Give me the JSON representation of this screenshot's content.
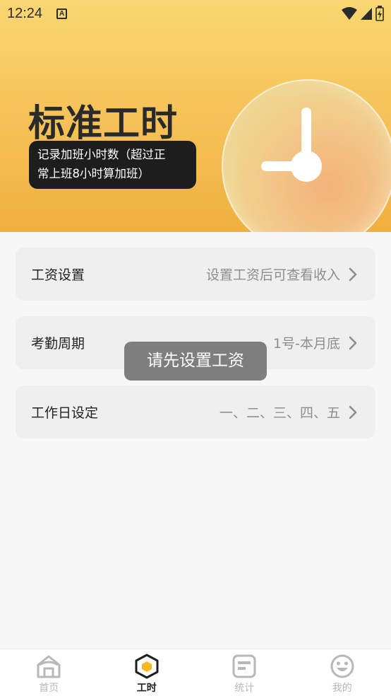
{
  "status_bar": {
    "time": "12:24",
    "notification_badge": "A"
  },
  "hero": {
    "title": "标准工时",
    "description_line1": "记录加班小时数（超过正",
    "description_line2": "常上班8小时算加班）",
    "illustration": "clock-icon"
  },
  "settings": [
    {
      "label": "工资设置",
      "value": "设置工资后可查看收入"
    },
    {
      "label": "考勤周期",
      "value": "1号-本月底"
    },
    {
      "label": "工作日设定",
      "value": "一、二、三、四、五"
    }
  ],
  "toast": "请先设置工资",
  "bottom_nav": [
    {
      "label": "首页",
      "icon": "home-icon",
      "active": false
    },
    {
      "label": "工时",
      "icon": "hexagon-icon",
      "active": true
    },
    {
      "label": "统计",
      "icon": "stats-icon",
      "active": false
    },
    {
      "label": "我的",
      "icon": "smiley-icon",
      "active": false
    }
  ],
  "colors": {
    "accent": "#f6c45a",
    "active_icon": "#f5b820",
    "inactive": "#b8b8b8"
  }
}
